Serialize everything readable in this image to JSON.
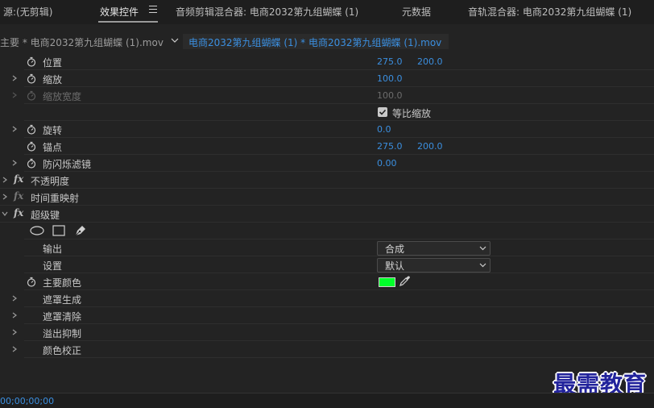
{
  "tabs": {
    "source": "源:(无剪辑)",
    "effects": "效果控件",
    "audio_mixer": "音频剪辑混合器: 电商2032第九组蝴蝶 (1)",
    "metadata": "元数据",
    "track_mixer": "音轨混合器: 电商2032第九组蝴蝶 (1)"
  },
  "sequence": {
    "master": "主要 * 电商2032第九组蝴蝶 (1).mov",
    "clip": "电商2032第九组蝴蝶 (1) * 电商2032第九组蝴蝶 (1).mov"
  },
  "props": {
    "position": {
      "label": "位置",
      "x": "275.0",
      "y": "200.0"
    },
    "scale": {
      "label": "缩放",
      "value": "100.0"
    },
    "scale_width": {
      "label": "缩放宽度",
      "value": "100.0"
    },
    "uniform_scale": {
      "label": "等比缩放",
      "checked": true
    },
    "rotation": {
      "label": "旋转",
      "value": "0.0"
    },
    "anchor": {
      "label": "锚点",
      "x": "275.0",
      "y": "200.0"
    },
    "antiflicker": {
      "label": "防闪烁滤镜",
      "value": "0.00"
    }
  },
  "effects": {
    "opacity": "不透明度",
    "time_remap": "时间重映射",
    "ultra_key": "超级键"
  },
  "ultra_key": {
    "output": {
      "label": "输出",
      "value": "合成"
    },
    "setting": {
      "label": "设置",
      "value": "默认"
    },
    "key_color": {
      "label": "主要颜色",
      "color": "#00ff2a"
    },
    "matte_generation": "遮罩生成",
    "matte_cleanup": "遮罩清除",
    "spill_suppression": "溢出抑制",
    "color_correction": "颜色校正"
  },
  "colors": {
    "accent": "#3b8fe0",
    "background": "#232323",
    "key": "#00ff2a"
  },
  "status": {
    "timecode": "00;00;00;00"
  },
  "watermark": "最需教育"
}
